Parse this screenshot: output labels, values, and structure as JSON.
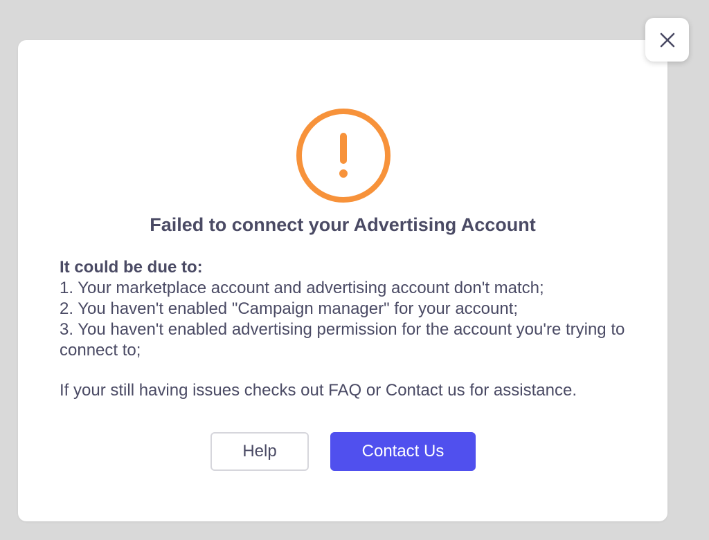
{
  "dialog": {
    "title": "Failed to connect your Advertising Account",
    "reasons_lead": "It could be due to:",
    "reasons": [
      "1. Your marketplace account and advertising account don't match;",
      "2. You haven't enabled \"Campaign manager\" for your account;",
      "3. You haven't enabled advertising permission for the account you're trying to connect to;"
    ],
    "footer_note": "If your still having issues checks out FAQ or Contact us for assistance.",
    "help_label": "Help",
    "contact_label": "Contact Us"
  },
  "icons": {
    "status": "warning-icon",
    "close": "close-icon"
  },
  "colors": {
    "warning": "#f7923a",
    "primary": "#5050ee",
    "text": "#4a4a64",
    "overlay": "#d9d9d9"
  }
}
